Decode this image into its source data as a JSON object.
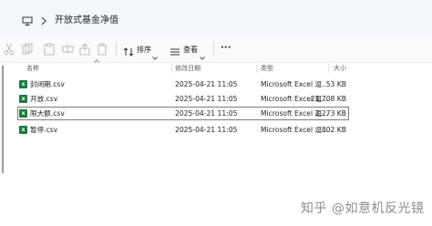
{
  "address_bar": {
    "path": "开放式基金净值"
  },
  "toolbar": {
    "sort_label": "排序",
    "view_label": "查看",
    "more_label": "···"
  },
  "columns": {
    "name": "名称",
    "date": "修改日期",
    "type": "类型",
    "size": "大小"
  },
  "files": [
    {
      "name": "封闭期.csv",
      "date": "2025-04-21 11:05",
      "type": "Microsoft Excel 逗...",
      "size": "53 KB"
    },
    {
      "name": "开放.csv",
      "date": "2025-04-21 11:05",
      "type": "Microsoft Excel 逗...",
      "size": "21,708 KB"
    },
    {
      "name": "限大额.csv",
      "date": "2025-04-21 11:05",
      "type": "Microsoft Excel 逗...",
      "size": "2,273 KB"
    },
    {
      "name": "暂停.csv",
      "date": "2025-04-21 11:05",
      "type": "Microsoft Excel 逗...",
      "size": "802 KB"
    }
  ],
  "selected_index": 2,
  "watermark": "知乎 @如意机反光镜",
  "colors": {
    "excel_green": "#1d7a43",
    "selection_border": "#7d7d7d"
  }
}
